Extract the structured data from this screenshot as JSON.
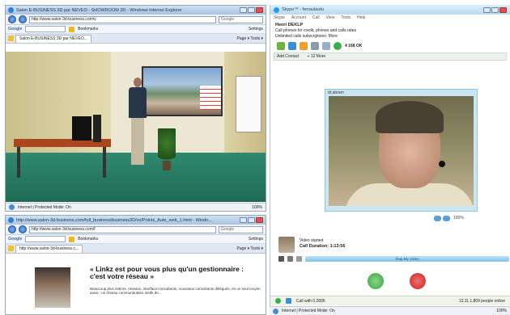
{
  "browser1": {
    "title": "Salon E-BUSINESS 3D par NEVEO - SHOWROOM 3D - Windows Internet Explorer",
    "url": "http://www.salon-3d-business.com/v",
    "search_placeholder": "Google",
    "google_label": "Google",
    "bookmarks": "Bookmarks",
    "settings": "Settings",
    "tab": "Salon E-BUSINESS 3D par NEVEO...",
    "tools": "Page ▾ Tools ▾",
    "status": "Internet | Protected Mode: On",
    "zoom": "100%"
  },
  "browser2": {
    "title": "http://www.salon-3d-business.com/full_business/business3D/vo/Points_Aute_web_1.html - Windo...",
    "url": "http://www.salon-3d-business.com/f",
    "search_placeholder": "Google",
    "google_label": "Google",
    "bookmarks": "Bookmarks",
    "settings": "Settings",
    "tab": "http://www.salon-3d-business.c...",
    "tools": "Page ▾ Tools ▾",
    "headline": "« Linkz est pour vous plus qu'un gestionnaire : c'est votre réseau »",
    "article_text": "Beaucoup plus interne, réseaux, interface consultants, nouveaux consultants délégués, en un seul moyen aussi : un réseau communautaire inédit de...",
    "status": "Internet | Protected Mode: On",
    "zoom": "100%"
  },
  "skype": {
    "title": "Skype™ - ferraulautu",
    "menu": [
      "Skype",
      "Account",
      "Call",
      "View",
      "Tools",
      "Help"
    ],
    "user_name": "Henri DEKLP",
    "credit_line": "Call phones for credit, phones and calls rates",
    "subscription_line": "Unlimited calls subscriptions: More",
    "online_count": "4 168 OK",
    "contacts_label": "Add Contact",
    "group_label": "+ 12 More",
    "video_label": "dr.abram",
    "self_status": "Video started",
    "call_duration_label": "Call Duration:",
    "call_duration": "1:13:56",
    "stop_video": "Stop My Video",
    "bottom_call": "Call with 0.2895",
    "bottom_online": "13.11.1,809 people online"
  },
  "taskbar": {
    "status": "Internet | Protected Mode: On",
    "zoom": "100%"
  }
}
